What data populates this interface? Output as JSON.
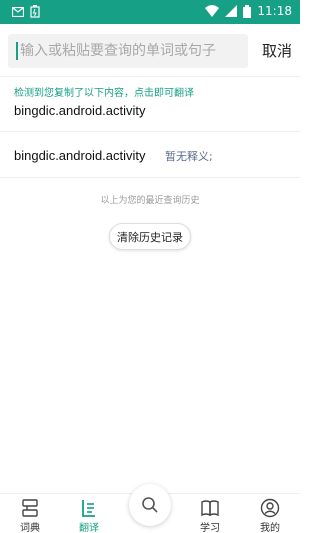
{
  "status_bar": {
    "time": "11:18",
    "bg_color": "#16a085",
    "icons": [
      "mail-icon",
      "battery-saver-icon",
      "wifi-icon",
      "signal-icon",
      "battery-icon"
    ]
  },
  "search": {
    "placeholder": "输入或粘贴要查询的单词或句子",
    "cancel_label": "取消"
  },
  "clipboard": {
    "hint": "检测到您复制了以下内容，点击即可翻译",
    "text": "bingdic.android.activity"
  },
  "history": {
    "items": [
      {
        "word": "bingdic.android.activity",
        "definition": "暂无释义;"
      }
    ],
    "note": "以上为您的最近查询历史",
    "clear_label": "清除历史记录"
  },
  "bottom_nav": {
    "accent": "#16a085",
    "items": [
      {
        "label": "词典",
        "icon": "dictionary-icon",
        "active": false
      },
      {
        "label": "翻译",
        "icon": "translate-icon",
        "active": true
      },
      {
        "label": "",
        "icon": "search-icon",
        "active": false
      },
      {
        "label": "学习",
        "icon": "book-icon",
        "active": false
      },
      {
        "label": "我的",
        "icon": "profile-icon",
        "active": false
      }
    ]
  }
}
